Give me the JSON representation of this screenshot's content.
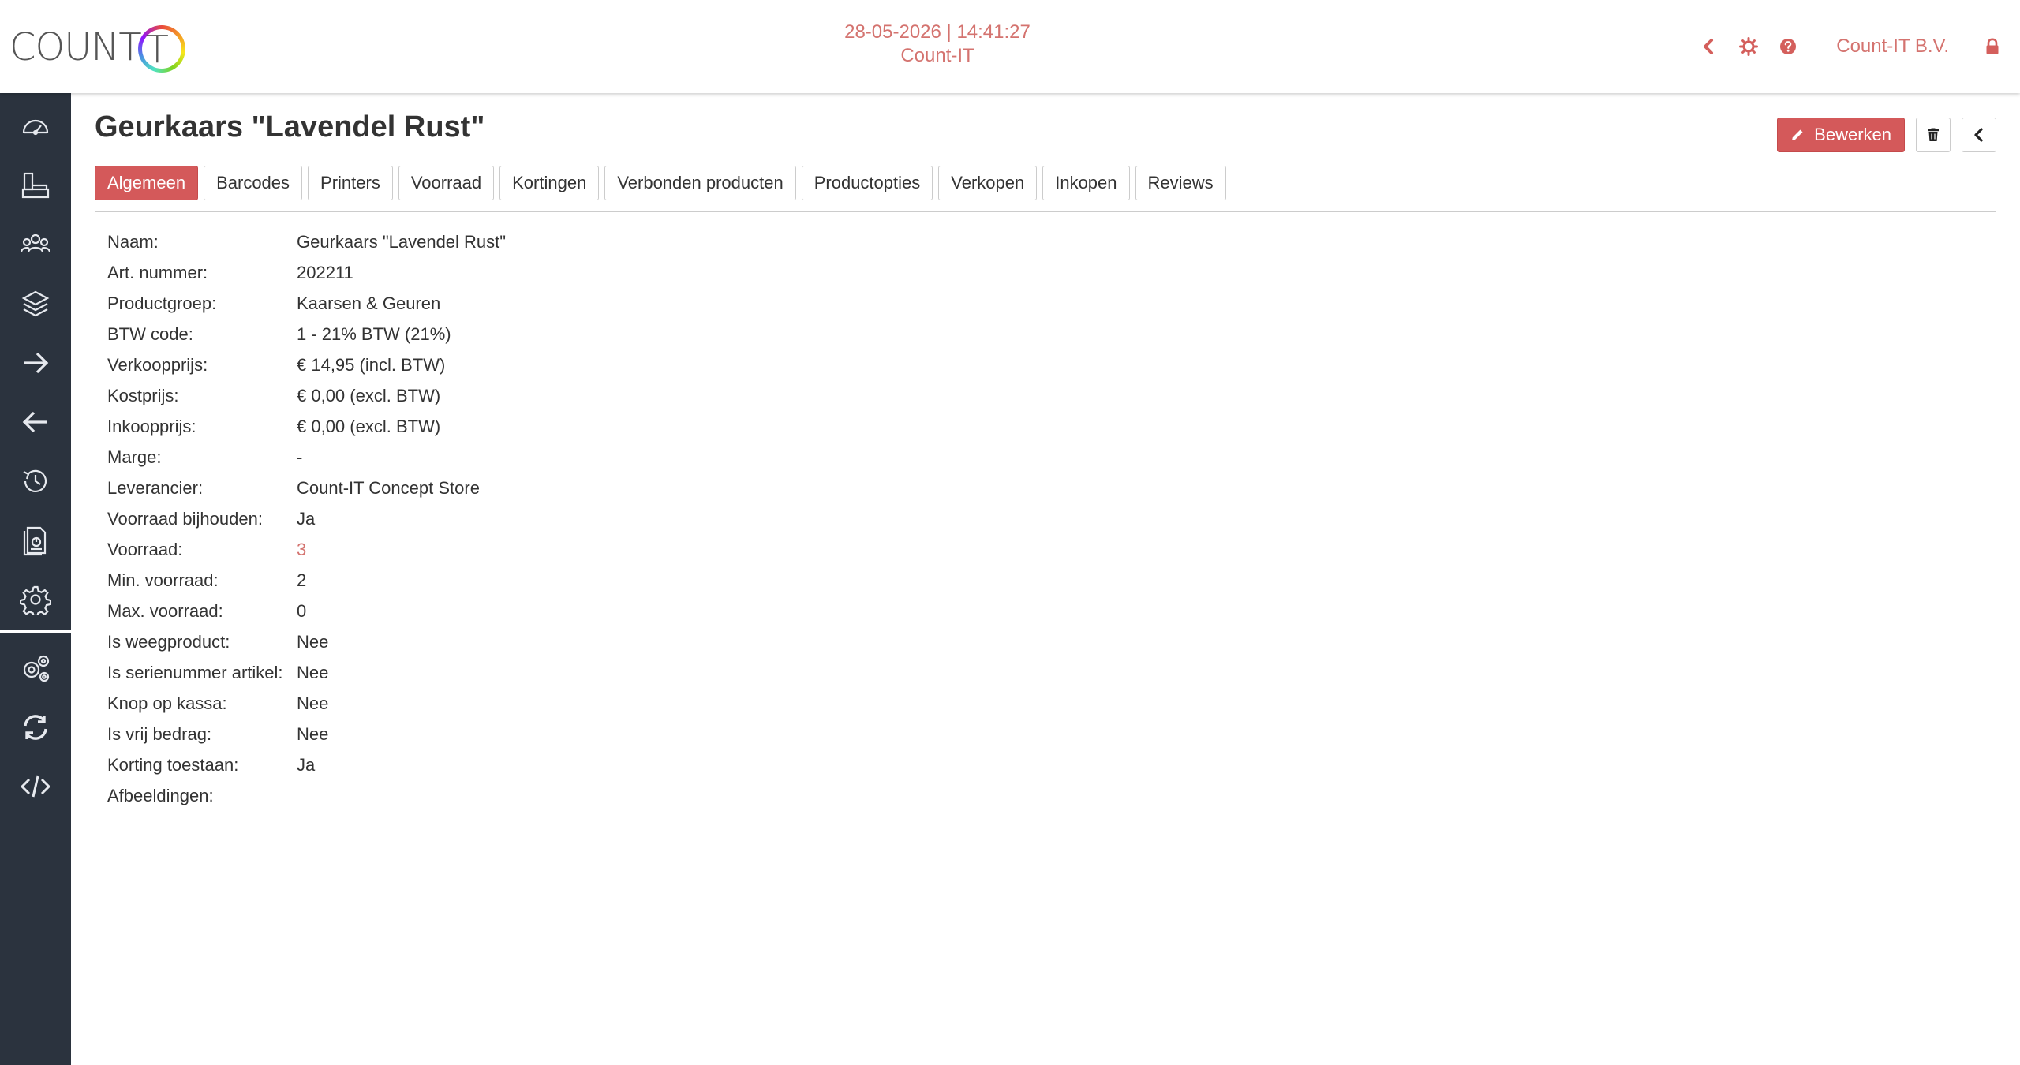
{
  "header": {
    "logo_text": "COUNT",
    "logo_t": "T",
    "datetime": "28-05-2026 | 14:41:27",
    "app_name": "Count-IT",
    "company": "Count-IT B.V.",
    "icons": [
      "chevron-left-icon",
      "gear-icon",
      "help-icon",
      "lock-icon"
    ]
  },
  "sidebar": {
    "items": [
      {
        "icon": "dashboard-icon"
      },
      {
        "icon": "pos-icon"
      },
      {
        "icon": "customers-icon"
      },
      {
        "icon": "products-icon"
      },
      {
        "icon": "arrow-right-icon"
      },
      {
        "icon": "arrow-left-icon"
      },
      {
        "icon": "history-icon"
      },
      {
        "icon": "reports-icon"
      },
      {
        "icon": "settings-icon"
      },
      {
        "icon": "advanced-settings-icon"
      },
      {
        "icon": "sync-icon"
      },
      {
        "icon": "code-icon"
      }
    ]
  },
  "page": {
    "title": "Geurkaars \"Lavendel Rust\"",
    "edit_label": "Bewerken"
  },
  "tabs": [
    {
      "label": "Algemeen",
      "active": true
    },
    {
      "label": "Barcodes"
    },
    {
      "label": "Printers"
    },
    {
      "label": "Voorraad"
    },
    {
      "label": "Kortingen"
    },
    {
      "label": "Verbonden producten"
    },
    {
      "label": "Productopties"
    },
    {
      "label": "Verkopen"
    },
    {
      "label": "Inkopen"
    },
    {
      "label": "Reviews"
    }
  ],
  "details": [
    {
      "label": "Naam:",
      "value": "Geurkaars \"Lavendel Rust\""
    },
    {
      "label": "Art. nummer:",
      "value": "202211"
    },
    {
      "label": "Productgroep:",
      "value": "Kaarsen & Geuren"
    },
    {
      "label": "BTW code:",
      "value": "1 - 21% BTW (21%)"
    },
    {
      "label": "Verkoopprijs:",
      "value": "€ 14,95 (incl. BTW)"
    },
    {
      "label": "Kostprijs:",
      "value": "€ 0,00 (excl. BTW)"
    },
    {
      "label": "Inkoopprijs:",
      "value": "€ 0,00 (excl. BTW)"
    },
    {
      "label": "Marge:",
      "value": "-"
    },
    {
      "label": "Leverancier:",
      "value": "Count-IT Concept Store"
    },
    {
      "label": "Voorraad bijhouden:",
      "value": "Ja"
    },
    {
      "label": "Voorraad:",
      "value": "3"
    },
    {
      "label": "Min. voorraad:",
      "value": "2"
    },
    {
      "label": "Max. voorraad:",
      "value": "0"
    },
    {
      "label": "Is weegproduct:",
      "value": "Nee"
    },
    {
      "label": "Is serienummer artikel:",
      "value": "Nee"
    },
    {
      "label": "Knop op kassa:",
      "value": "Nee"
    },
    {
      "label": "Is vrij bedrag:",
      "value": "Nee"
    },
    {
      "label": "Korting toestaan:",
      "value": "Ja"
    },
    {
      "label": "Afbeeldingen:",
      "value": ""
    }
  ],
  "colors": {
    "accent": "#d4595a",
    "sidebar": "#2b333e"
  }
}
